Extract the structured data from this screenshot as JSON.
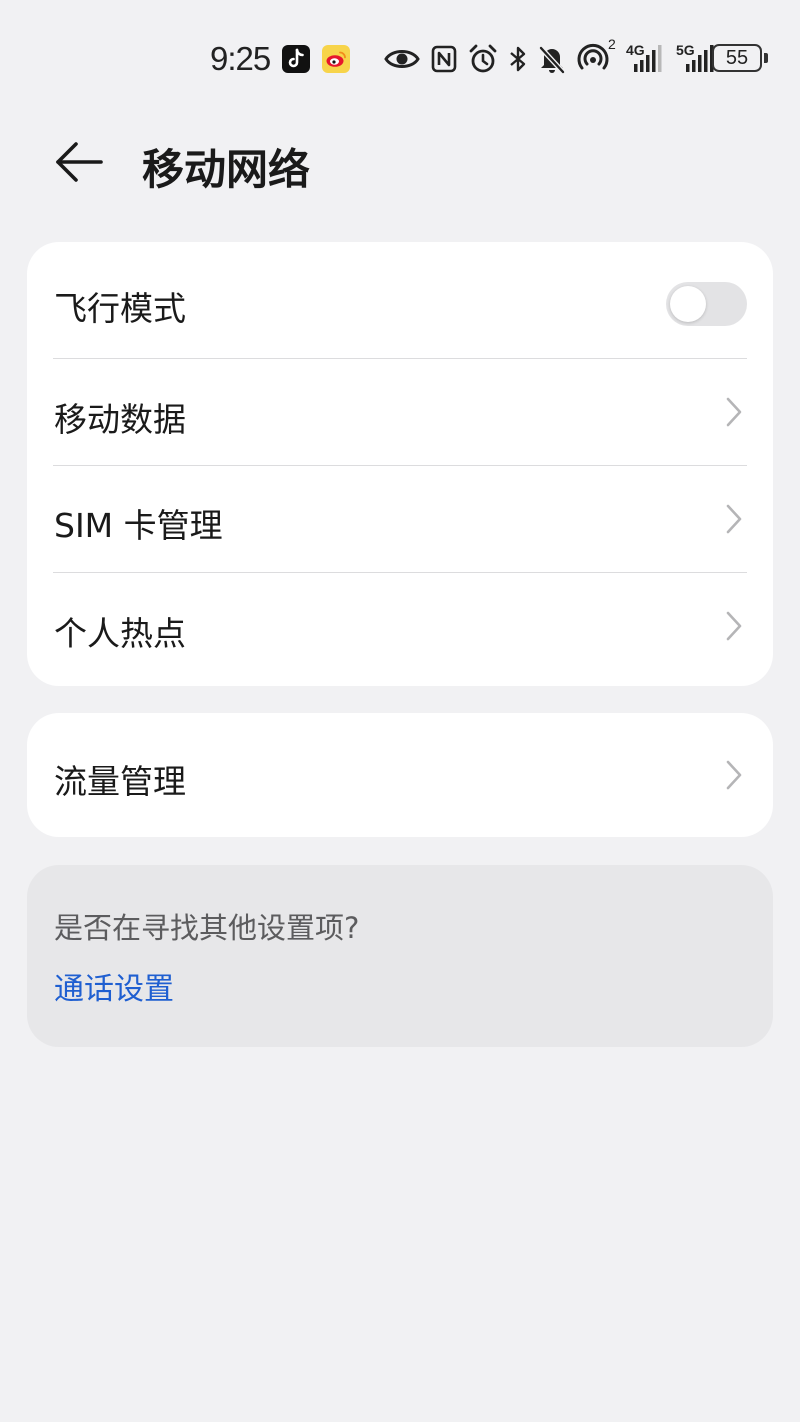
{
  "status_bar": {
    "time": "9:25",
    "battery": "55",
    "icons": [
      "tiktok-icon",
      "weibo-icon",
      "eye-icon",
      "nfc-icon",
      "alarm-icon",
      "bluetooth-icon",
      "bell-off-icon",
      "hotspot-icon",
      "signal-4g-icon",
      "signal-5g-icon",
      "battery-icon"
    ],
    "hotspot_count": "2",
    "sim1_network": "4G",
    "sim2_network": "5G"
  },
  "header": {
    "title": "移动网络"
  },
  "section1": {
    "items": [
      {
        "label": "飞行模式",
        "type": "toggle",
        "on": false
      },
      {
        "label": "移动数据",
        "type": "nav"
      },
      {
        "label": "SIM 卡管理",
        "type": "nav"
      },
      {
        "label": "个人热点",
        "type": "nav"
      }
    ]
  },
  "section2": {
    "items": [
      {
        "label": "流量管理",
        "type": "nav"
      }
    ]
  },
  "suggestion": {
    "question": "是否在寻找其他设置项?",
    "link": "通话设置"
  },
  "colors": {
    "background": "#f1f1f3",
    "card": "#ffffff",
    "suggestion_card": "#e7e7e9",
    "link": "#1f5fd1"
  }
}
